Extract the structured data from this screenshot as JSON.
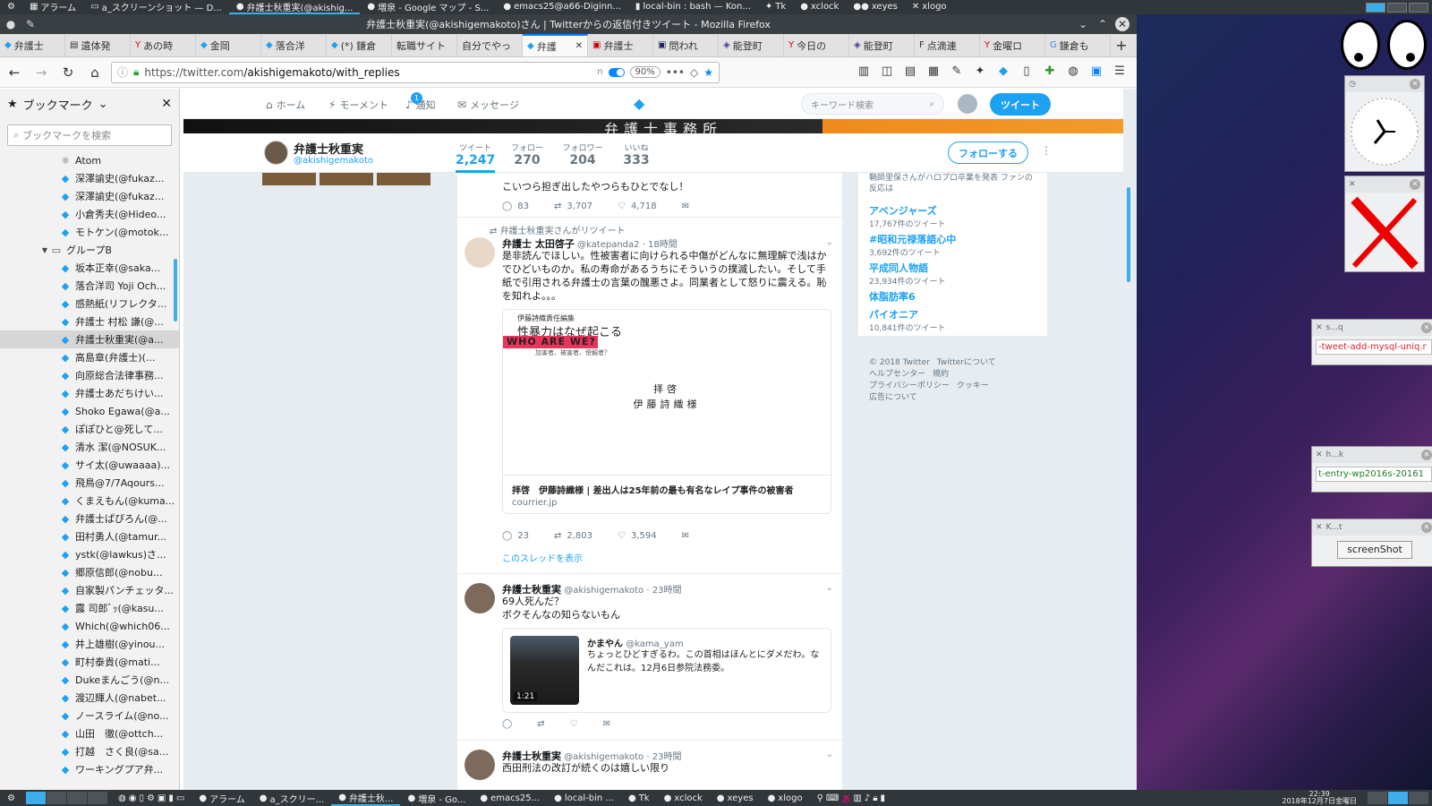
{
  "os_topbar": {
    "items": [
      {
        "icon": "gear-icon",
        "label": ""
      },
      {
        "icon": "calendar-icon",
        "label": "アラーム"
      },
      {
        "icon": "window-icon",
        "label": "a_スクリーンショット — D..."
      },
      {
        "icon": "firefox-icon",
        "label": "弁護士秋重実(@akishig..."
      },
      {
        "icon": "firefox-icon",
        "label": "増泉 - Google マップ - S..."
      },
      {
        "icon": "emacs-icon",
        "label": "emacs25@a66-Diginn..."
      },
      {
        "icon": "terminal-icon",
        "label": "local-bin : bash — Kon..."
      },
      {
        "icon": "tk-icon",
        "label": "Tk"
      },
      {
        "icon": "clock-icon",
        "label": "xclock"
      },
      {
        "icon": "eyes-icon",
        "label": "xeyes"
      },
      {
        "icon": "x-icon",
        "label": "xlogo"
      }
    ]
  },
  "window": {
    "title": "弁護士秋重実(@akishigemakoto)さん | Twitterからの返信付きツイート - Mozilla Firefox"
  },
  "tabs": [
    {
      "icon": "twitter-icon",
      "label": "弁護士"
    },
    {
      "icon": "page-icon",
      "label": "遺体発"
    },
    {
      "icon": "yahoo-icon",
      "label": "あの時"
    },
    {
      "icon": "twitter-icon",
      "label": "金岡"
    },
    {
      "icon": "twitter-icon",
      "label": "落合洋"
    },
    {
      "icon": "twitter-icon",
      "label": "(*) 鎌倉"
    },
    {
      "icon": "page-icon",
      "label": "転職サイト"
    },
    {
      "icon": "page-icon",
      "label": "自分でやっ"
    },
    {
      "icon": "twitter-icon",
      "label": "弁護",
      "active": true
    },
    {
      "icon": "page-icon",
      "label": "弁護士"
    },
    {
      "icon": "page-icon",
      "label": "問われ"
    },
    {
      "icon": "page-icon",
      "label": "能登町"
    },
    {
      "icon": "yahoo-icon",
      "label": "今日の"
    },
    {
      "icon": "page-icon",
      "label": "能登町"
    },
    {
      "icon": "page-icon",
      "label": "点滴連"
    },
    {
      "icon": "yahoo-icon",
      "label": "金曜ロ"
    },
    {
      "icon": "google-icon",
      "label": "鎌倉も"
    }
  ],
  "urlbar": {
    "prefix": "https://twitter.com",
    "path": "/akishigemakoto/with_replies",
    "zoom": "90%"
  },
  "sidebar": {
    "title": "ブックマーク",
    "search_placeholder": "ブックマークを検索",
    "items": [
      {
        "label": "Atom",
        "icon": "atom-icon",
        "indent": 1
      },
      {
        "label": "深澤諭史(@fukaz...",
        "icon": "twitter-icon",
        "indent": 1
      },
      {
        "label": "深澤諭史(@fukaz...",
        "icon": "twitter-icon",
        "indent": 1
      },
      {
        "label": "小倉秀夫(@Hideo...",
        "icon": "twitter-icon",
        "indent": 1
      },
      {
        "label": "モトケン(@motok...",
        "icon": "twitter-icon",
        "indent": 1
      },
      {
        "label": "グループB",
        "icon": "folder-icon",
        "indent": 0,
        "folder": true
      },
      {
        "label": "坂本正幸(@saka...",
        "icon": "twitter-icon",
        "indent": 1
      },
      {
        "label": "落合洋司 Yoji Och...",
        "icon": "twitter-icon",
        "indent": 1
      },
      {
        "label": "感熱紙(リフレクタ...",
        "icon": "twitter-icon",
        "indent": 1
      },
      {
        "label": "弁護士 村松 謙(@...",
        "icon": "twitter-icon",
        "indent": 1
      },
      {
        "label": "弁護士秋重実(@a...",
        "icon": "twitter-icon",
        "indent": 1,
        "selected": true
      },
      {
        "label": "高島章(弁護士)(...",
        "icon": "twitter-icon",
        "indent": 1
      },
      {
        "label": "向原総合法律事務...",
        "icon": "twitter-icon",
        "indent": 1
      },
      {
        "label": "弁護士あだちけい...",
        "icon": "twitter-icon",
        "indent": 1
      },
      {
        "label": "Shoko Egawa(@a...",
        "icon": "twitter-icon",
        "indent": 1
      },
      {
        "label": "ぽぽひと@死して...",
        "icon": "twitter-icon",
        "indent": 1
      },
      {
        "label": "清水 潔(@NOSUK...",
        "icon": "twitter-icon",
        "indent": 1
      },
      {
        "label": "サイ太(@uwaaaa)...",
        "icon": "twitter-icon",
        "indent": 1
      },
      {
        "label": "飛鳥@7/7Aqours...",
        "icon": "twitter-icon",
        "indent": 1
      },
      {
        "label": "くまえもん(@kuma...",
        "icon": "twitter-icon",
        "indent": 1
      },
      {
        "label": "弁護士ぱぴろん(@...",
        "icon": "twitter-icon",
        "indent": 1
      },
      {
        "label": "田村勇人(@tamur...",
        "icon": "twitter-icon",
        "indent": 1
      },
      {
        "label": "ystk(@lawkus)さ...",
        "icon": "twitter-icon",
        "indent": 1
      },
      {
        "label": "郷原信郎(@nobu...",
        "icon": "twitter-icon",
        "indent": 1
      },
      {
        "label": "自家製パンチェッタ...",
        "icon": "twitter-icon",
        "indent": 1
      },
      {
        "label": "露 司郎ﾞｯ(@kasu...",
        "icon": "twitter-icon",
        "indent": 1
      },
      {
        "label": "Which(@which06...",
        "icon": "twitter-icon",
        "indent": 1
      },
      {
        "label": "井上雄樹(@yinou...",
        "icon": "twitter-icon",
        "indent": 1
      },
      {
        "label": "町村泰貴(@mati...",
        "icon": "twitter-icon",
        "indent": 1
      },
      {
        "label": "Dukeまんごう(@n...",
        "icon": "twitter-icon",
        "indent": 1
      },
      {
        "label": "渡辺輝人(@nabet...",
        "icon": "twitter-icon",
        "indent": 1
      },
      {
        "label": "ノースライム(@no...",
        "icon": "twitter-icon",
        "indent": 1
      },
      {
        "label": "山田　徹(@ottch...",
        "icon": "twitter-icon",
        "indent": 1
      },
      {
        "label": "打越　さく良(@sa...",
        "icon": "twitter-icon",
        "indent": 1
      },
      {
        "label": "ワーキングプア弁...",
        "icon": "twitter-icon",
        "indent": 1
      }
    ]
  },
  "twitter": {
    "nav": {
      "home": "ホーム",
      "moments": "モーメント",
      "notifications": "通知",
      "notifications_badge": "1",
      "messages": "メッセージ",
      "search_placeholder": "キーワード検索",
      "tweet_button": "ツイート"
    },
    "profile": {
      "name": "弁護士秋重実",
      "handle": "@akishigemakoto",
      "follow_button": "フォローする",
      "stats": [
        {
          "label": "ツイート",
          "value": "2,247",
          "active": true
        },
        {
          "label": "フォロー",
          "value": "270"
        },
        {
          "label": "フォロワー",
          "value": "204"
        },
        {
          "label": "いいね",
          "value": "333"
        }
      ]
    },
    "tweets": {
      "t0": {
        "text": "こいつら担ぎ出したやつらもひとでなし！",
        "replies": "83",
        "retweets": "3,707",
        "likes": "4,718"
      },
      "t1": {
        "retweet_note": "弁護士秋重実さんがリツイート",
        "name": "弁護士 太田啓子",
        "handle": "@katepanda2",
        "time": "· 18時間",
        "text": "是非読んでほしい。性被害者に向けられる中傷がどんなに無理解で浅はかでひどいものか。私の寿命があるうちにそういうの撲滅したい。そして手紙で引用される弁護士の言葉の醜悪さよ。同業者として怒りに震える。恥を知れよ。。。",
        "card_small": "伊藤詩織責任編集",
        "card_headline": "性暴力はなぜ起こる",
        "card_banner": "WHO ARE WE?",
        "card_sub": "加害者、被害者、傍観者？",
        "card_greeting": "拝啓",
        "card_addressee": "伊藤詩織様",
        "card_title": "拝啓　伊藤詩織様 | 差出人は25年前の最も有名なレイプ事件の被害者",
        "card_domain": "courrier.jp",
        "replies": "23",
        "retweets": "2,803",
        "likes": "3,594",
        "thread_link": "このスレッドを表示"
      },
      "t2": {
        "name": "弁護士秋重実",
        "handle": "@akishigemakoto",
        "time": "· 23時間",
        "text_line1": "69人死んだ？",
        "text_line2": "ボクそんなの知らないもん",
        "quote_name": "かまやん",
        "quote_handle": "@kama_yam",
        "quote_text": "ちょっとひどすぎるわ。この首相はほんとにダメだわ。なんだこれは。12月6日参院法務委。",
        "video_duration": "1:21"
      },
      "t3": {
        "name": "弁護士秋重実",
        "handle": "@akishigemakoto",
        "time": "· 23時間",
        "text": "西田刑法の改訂が続くのは嬉しい限り"
      }
    },
    "trends": [
      {
        "name": "",
        "desc": "鞘師里保さんがハロプロ卒業を発表 ファンの反応は"
      },
      {
        "name": "アベンジャーズ",
        "count": "17,767件のツイート"
      },
      {
        "name": "#昭和元禄落語心中",
        "count": "3,692件のツイート"
      },
      {
        "name": "平成同人物語",
        "count": "23,934件のツイート"
      },
      {
        "name": "体脂肪率6",
        "count": ""
      },
      {
        "name": "パイオニア",
        "count": "10,841件のツイート"
      }
    ],
    "footer": {
      "copyright": "© 2018 Twitter",
      "about": "Twitterについて",
      "help": "ヘルプセンター",
      "terms": "規約",
      "privacy": "プライバシーポリシー",
      "cookie": "クッキー",
      "ads": "広告について"
    }
  },
  "desktop": {
    "win1_title": "s...q",
    "win1_text": "-tweet-add-mysql-uniq.r",
    "win2_title": "h...k",
    "win2_text": "t-entry-wp2016s-20161",
    "win3_title": "K...t",
    "win3_button": "screenShot"
  },
  "taskbar": {
    "items": [
      {
        "label": "アラーム"
      },
      {
        "label": "a_スクリー..."
      },
      {
        "label": "弁護士秋...",
        "active": true
      },
      {
        "label": "増泉 - Go..."
      },
      {
        "label": "emacs25..."
      },
      {
        "label": "local-bin ..."
      },
      {
        "label": "Tk"
      },
      {
        "label": "xclock"
      },
      {
        "label": "xeyes"
      },
      {
        "label": "xlogo"
      }
    ],
    "time": "22:39",
    "date": "2018年12月7日金曜日"
  },
  "colors": {
    "twitter_blue": "#1da1f2",
    "firefox_blue": "#0a84ff",
    "kde_accent": "#3daee9",
    "card_banner_red": "#e8335a"
  }
}
